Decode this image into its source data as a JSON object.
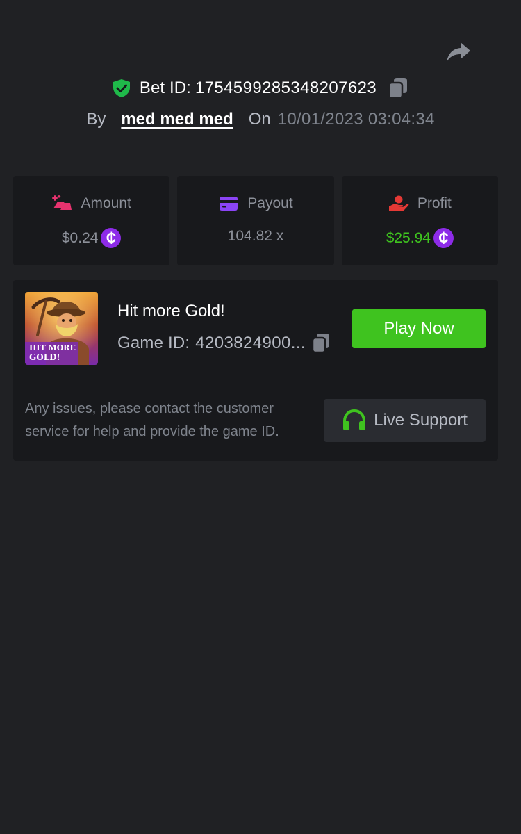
{
  "header": {
    "share_icon": "share-arrow-icon",
    "bet_id_label": "Bet ID:",
    "bet_id_value": "1754599285348207623",
    "verified_icon": "shield-check-icon",
    "copy_icon": "copy-icon",
    "by_label": "By",
    "username": "med med med",
    "on_label": "On",
    "date": "10/01/2023 03:04:34"
  },
  "stats": [
    {
      "label": "Amount",
      "value": "$0.24",
      "icon": "gold-bar-icon",
      "currency_symbol": "₵",
      "has_coin": true
    },
    {
      "label": "Payout",
      "value": "104.82 x",
      "icon": "wallet-card-icon",
      "has_coin": false
    },
    {
      "label": "Profit",
      "value": "$25.94",
      "icon": "hand-money-icon",
      "currency_symbol": "₵",
      "has_coin": true
    }
  ],
  "game": {
    "title": "Hit more Gold!",
    "id_label": "Game ID:",
    "id_value": "4203824900...",
    "thumbnail_text": "HIT MORE GOLD!",
    "play_button": "Play Now"
  },
  "support": {
    "text": "Any issues, please contact the customer service for help and provide the game ID.",
    "button_label": "Live Support",
    "button_icon": "headphones-icon"
  },
  "colors": {
    "background": "#202124",
    "card": "#18191c",
    "accent_green": "#3fc31f",
    "coin_purple": "#8d2be8",
    "amount_icon": "#e8336f",
    "payout_icon": "#8b44f5",
    "profit_icon": "#e53935"
  }
}
